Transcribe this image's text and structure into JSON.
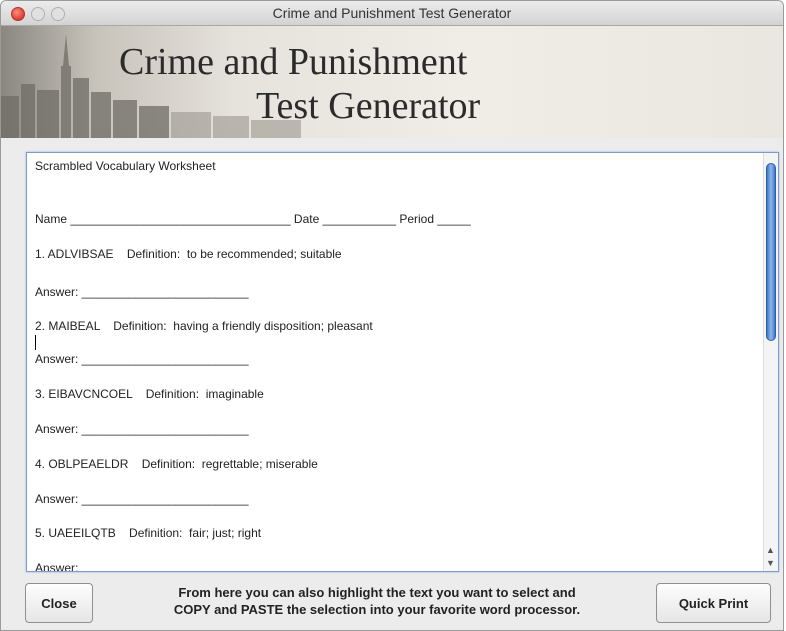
{
  "window": {
    "title": "Crime and Punishment Test Generator"
  },
  "banner": {
    "line1": "Crime and Punishment",
    "line2": "Test Generator"
  },
  "worksheet": {
    "heading": "Scrambled Vocabulary Worksheet",
    "name_line": "Name _________________________________ Date ___________ Period _____",
    "items": [
      {
        "question": "1. ADLVIBSAE    Definition:  to be recommended; suitable",
        "answer": "Answer: _________________________"
      },
      {
        "question": "2. MAIBEAL    Definition:  having a friendly disposition; pleasant",
        "answer": "Answer: _________________________"
      },
      {
        "question": "3. EIBAVCNCOEL    Definition:  imaginable",
        "answer": "Answer: _________________________"
      },
      {
        "question": "4. OBLPEAELDR    Definition:  regrettable; miserable",
        "answer": "Answer: _________________________"
      },
      {
        "question": "5. UAEEILQTB    Definition:  fair; just; right",
        "answer": "Answer: _________________________"
      }
    ]
  },
  "buttons": {
    "close": "Close",
    "quick_print": "Quick Print"
  },
  "hint": {
    "line1": "From here you can also highlight the text you want to select and",
    "line2": "COPY and PASTE the selection into your favorite word processor."
  }
}
